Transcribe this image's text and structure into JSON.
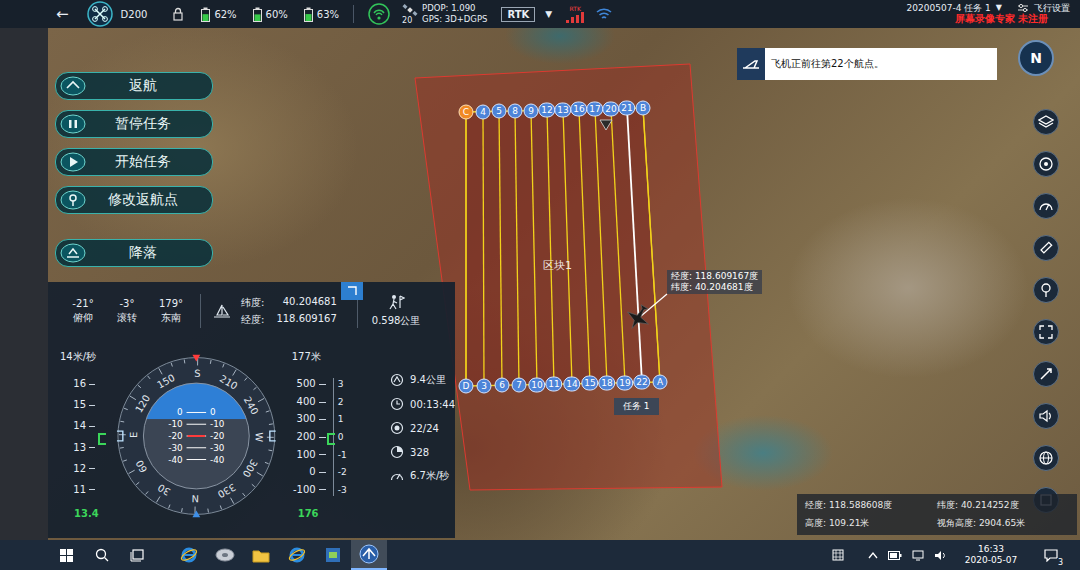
{
  "top_bar": {
    "back": "←",
    "aircraft": "D200",
    "batteries": [
      {
        "reading": "62%",
        "level": 0.62
      },
      {
        "reading": "60%",
        "level": 0.6
      },
      {
        "reading": "63%",
        "level": 0.63
      }
    ],
    "satellites": "20",
    "pdop": "PDOP: 1.090",
    "gps": "GPS: 3D+DGPS",
    "rtk": "RTK",
    "rtk_arrow": "▼",
    "rtk_signal": "RTK",
    "mission": "20200507-4 任务 1",
    "mission_arrow": "▼",
    "settings": "飞行设置",
    "watermark": "屏幕录像专家 未注册"
  },
  "commands": [
    {
      "label": "返航"
    },
    {
      "label": "暂停任务"
    },
    {
      "label": "开始任务"
    },
    {
      "label": "修改返航点"
    },
    {
      "label": "降落"
    }
  ],
  "notice": "飞机正前往第22个航点。",
  "compass": "N",
  "map": {
    "block": "区块1",
    "mission": "任务 1",
    "tooltip": {
      "lon": "经度: 118.609167度",
      "lat": "纬度: 40.204681度"
    },
    "top_waypoints": [
      {
        "label": "C",
        "kind": "start",
        "target": false
      },
      {
        "label": "4",
        "kind": "waypoint",
        "target": false
      },
      {
        "label": "5",
        "kind": "waypoint",
        "target": false
      },
      {
        "label": "8",
        "kind": "waypoint",
        "target": false
      },
      {
        "label": "9",
        "kind": "waypoint",
        "target": false
      },
      {
        "label": "12",
        "kind": "waypoint",
        "target": false
      },
      {
        "label": "13",
        "kind": "waypoint",
        "target": false
      },
      {
        "label": "16",
        "kind": "waypoint",
        "target": false
      },
      {
        "label": "17",
        "kind": "waypoint",
        "target": false
      },
      {
        "label": "20",
        "kind": "waypoint",
        "target": false
      },
      {
        "label": "21",
        "kind": "waypoint",
        "target": false
      },
      {
        "label": "B",
        "kind": "waypoint",
        "target": false
      }
    ],
    "bottom_waypoints": [
      {
        "label": "D",
        "kind": "waypoint",
        "target": false
      },
      {
        "label": "3",
        "kind": "waypoint",
        "target": false
      },
      {
        "label": "6",
        "kind": "waypoint",
        "target": false
      },
      {
        "label": "7",
        "kind": "waypoint",
        "target": false
      },
      {
        "label": "10",
        "kind": "waypoint",
        "target": false
      },
      {
        "label": "11",
        "kind": "waypoint",
        "target": false
      },
      {
        "label": "14",
        "kind": "waypoint",
        "target": false
      },
      {
        "label": "15",
        "kind": "waypoint",
        "target": false
      },
      {
        "label": "18",
        "kind": "waypoint",
        "target": false
      },
      {
        "label": "19",
        "kind": "waypoint",
        "target": false
      },
      {
        "label": "22",
        "kind": "waypoint",
        "target": true
      },
      {
        "label": "A",
        "kind": "waypoint",
        "target": false
      }
    ]
  },
  "telemetry": {
    "pitch": {
      "value": "-21°",
      "label": "俯仰"
    },
    "roll": {
      "value": "-3°",
      "label": "滚转"
    },
    "heading": {
      "value": "179°",
      "label": "东南"
    },
    "lat": {
      "label": "纬度:",
      "value": "40.204681"
    },
    "lon": {
      "label": "经度:",
      "value": "118.609167"
    },
    "distance": "0.598公里",
    "speed_tape": {
      "title": "14米/秒",
      "ticks": [
        "16",
        "15",
        "14",
        "13",
        "12",
        "11"
      ],
      "reading": "13.4"
    },
    "horizon": {
      "sky_level": 0.34,
      "heading": 179,
      "ring": [
        "N",
        "30",
        "60",
        "E",
        "120",
        "150",
        "S",
        "210",
        "240",
        "W",
        "300",
        "330"
      ],
      "ladder": [
        {
          "left": "0",
          "right": "0"
        },
        {
          "left": "-10",
          "right": "-10"
        },
        {
          "left": "-20",
          "right": "-20"
        },
        {
          "left": "-30",
          "right": "-30"
        },
        {
          "left": "-40",
          "right": "-40"
        }
      ]
    },
    "altitude_tape": {
      "title": "177米",
      "ticks": [
        "500",
        "400",
        "300",
        "200",
        "100",
        "0",
        "-100"
      ],
      "vs_ticks": [
        "3",
        "2",
        "1",
        "0",
        "-1",
        "-2",
        "-3"
      ],
      "reading": "176"
    },
    "stats": [
      {
        "text": "9.4公里"
      },
      {
        "text": "00:13:44"
      },
      {
        "text": "22/24"
      },
      {
        "text": "328"
      },
      {
        "text": "6.7米/秒"
      }
    ]
  },
  "view_info": {
    "lon": "经度: 118.588608度",
    "lat": "纬度: 40.214252度",
    "height": "高度: 109.21米",
    "view_height": "视角高度: 2904.65米"
  },
  "taskbar": {
    "apps": [
      {
        "kind": "ie",
        "active": false
      },
      {
        "kind": "disk",
        "active": false
      },
      {
        "kind": "folder",
        "active": false
      },
      {
        "kind": "ie",
        "active": false
      },
      {
        "kind": "doc",
        "active": false
      },
      {
        "kind": "gcs",
        "active": true
      }
    ],
    "time": "16:33",
    "date": "2020-05-07",
    "notifications": "3"
  }
}
